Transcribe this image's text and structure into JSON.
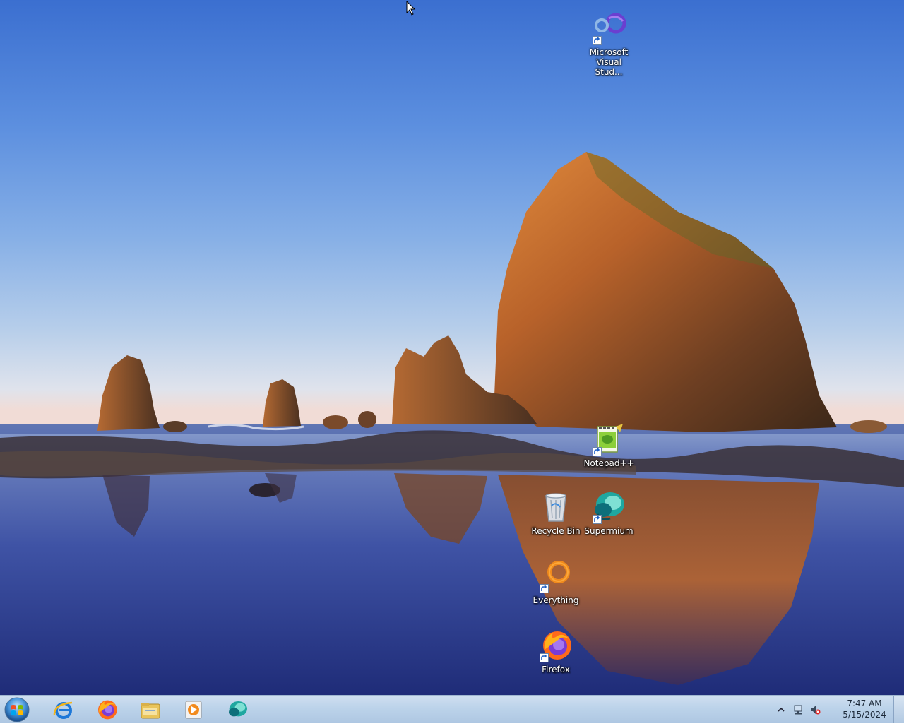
{
  "desktop": {
    "icons": [
      {
        "id": "vs",
        "label": "Microsoft\nVisual Stud...",
        "icon": "visual-studio-icon",
        "shortcut": true
      },
      {
        "id": "npp",
        "label": "Notepad++",
        "icon": "notepad-plus-plus-icon",
        "shortcut": true
      },
      {
        "id": "recycle",
        "label": "Recycle Bin",
        "icon": "recycle-bin-icon",
        "shortcut": false
      },
      {
        "id": "supermium",
        "label": "Supermium",
        "icon": "supermium-icon",
        "shortcut": true
      },
      {
        "id": "everything",
        "label": "Everything",
        "icon": "everything-search-icon",
        "shortcut": true
      },
      {
        "id": "firefox",
        "label": "Firefox",
        "icon": "firefox-icon",
        "shortcut": true
      }
    ]
  },
  "taskbar": {
    "start_icon": "windows-orb-icon",
    "pinned": [
      {
        "name": "Internet Explorer",
        "icon": "internet-explorer-icon"
      },
      {
        "name": "Firefox",
        "icon": "firefox-icon"
      },
      {
        "name": "Windows Explorer",
        "icon": "folder-icon"
      },
      {
        "name": "Windows Media Player",
        "icon": "media-player-icon"
      },
      {
        "name": "Supermium",
        "icon": "supermium-icon"
      }
    ],
    "tray": {
      "icons": [
        "show-hidden-icons-chevron",
        "network-icon",
        "volume-muted-icon"
      ],
      "time": "7:47 AM",
      "date": "5/15/2024"
    }
  },
  "colors": {
    "taskbar": "#bcd3ea",
    "label_text": "#ffffff",
    "sky_top": "#3b6fd0",
    "sea": "#2c3f8f"
  }
}
